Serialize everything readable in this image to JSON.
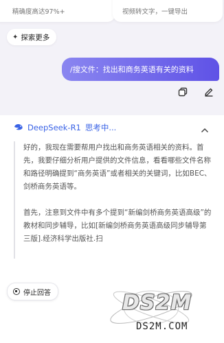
{
  "top_cards": {
    "left_text": "精确度高达97%+",
    "right_text": "视频转文字，一键导出"
  },
  "explore": {
    "label": "探索更多",
    "icon": "sparkle-icon"
  },
  "user_message": {
    "text": "/搜文件：找出和商务英语有关的资料"
  },
  "message_actions": [
    {
      "name": "copy-icon"
    },
    {
      "name": "edit-icon"
    }
  ],
  "assistant": {
    "model": "DeepSeek-R1",
    "status": "思考中...",
    "thinking": [
      "好的，我现在需要帮用户找出和商务英语相关的资料。首先，我要仔细分析用户提供的文件信息，看看哪些文件名称和路径明确提到“商务英语”或者相关的关键词，比如BEC、剑桥商务英语等。",
      "首先，注意到文件中有多个提到“新编剑桥商务英语高级”的教材和同步辅导，比如[新编剑桥商务英语高级同步辅导第三版].经济科学出版社.扫"
    ]
  },
  "stop_button": {
    "label": "停止回答"
  },
  "watermark": {
    "main": "DS2M",
    "sub": "DS2M.COM"
  },
  "colors": {
    "accent": "#5f52e6",
    "link": "#3a63e6"
  }
}
